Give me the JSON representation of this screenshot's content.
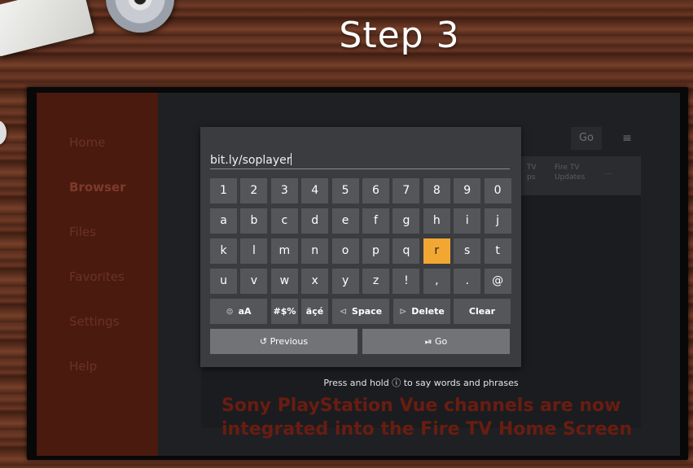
{
  "title": "Step 3",
  "sidebar": {
    "items": [
      "Home",
      "Browser",
      "Files",
      "Favorites",
      "Settings",
      "Help"
    ],
    "active": "Browser"
  },
  "topbar": {
    "go": "Go",
    "menu": "≡"
  },
  "nav": {
    "item1_l1": "TV",
    "item1_l2": "ps",
    "item2_l1": "Fire TV",
    "item2_l2": "Updates",
    "more": "..."
  },
  "keyboard": {
    "url_value": "bit.ly/soplayer",
    "rows": [
      [
        "1",
        "2",
        "3",
        "4",
        "5",
        "6",
        "7",
        "8",
        "9",
        "0"
      ],
      [
        "a",
        "b",
        "c",
        "d",
        "e",
        "f",
        "g",
        "h",
        "i",
        "j"
      ],
      [
        "k",
        "l",
        "m",
        "n",
        "o",
        "p",
        "q",
        "r",
        "s",
        "t"
      ],
      [
        "u",
        "v",
        "w",
        "x",
        "y",
        "z",
        "!",
        ",",
        ".",
        "@"
      ]
    ],
    "highlighted_key": "r",
    "func": {
      "case": "aA",
      "symbols": "#$%",
      "accents": "äçé",
      "space": "Space",
      "delete": "Delete",
      "clear": "Clear"
    },
    "previous": "Previous",
    "go": "Go"
  },
  "hint": "Press and hold ⓘ to say words and phrases",
  "headline": "Sony PlayStation Vue channels are now integrated into the Fire TV Home Screen",
  "colors": {
    "highlight": "#f2a733",
    "sidebar_bg": "#4a1a0f",
    "headline": "#6a1c10"
  }
}
